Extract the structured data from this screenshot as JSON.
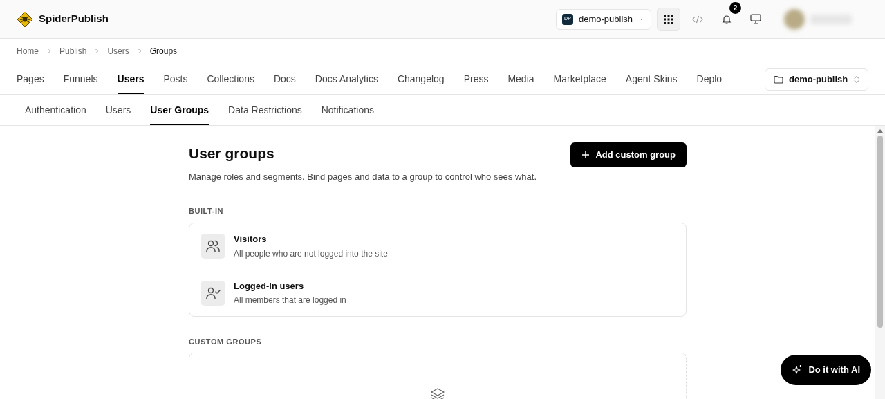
{
  "app": {
    "name": "SpiderPublish"
  },
  "header": {
    "workspace": {
      "badge": "DP",
      "name": "demo-publish"
    },
    "notifications": {
      "count": "2"
    }
  },
  "breadcrumb": [
    "Home",
    "Publish",
    "Users",
    "Groups"
  ],
  "tabs": [
    {
      "label": "Pages",
      "selected": false
    },
    {
      "label": "Funnels",
      "selected": false
    },
    {
      "label": "Users",
      "selected": true
    },
    {
      "label": "Posts",
      "selected": false
    },
    {
      "label": "Collections",
      "selected": false
    },
    {
      "label": "Docs",
      "selected": false
    },
    {
      "label": "Docs Analytics",
      "selected": false
    },
    {
      "label": "Changelog",
      "selected": false
    },
    {
      "label": "Press",
      "selected": false
    },
    {
      "label": "Media",
      "selected": false
    },
    {
      "label": "Marketplace",
      "selected": false
    },
    {
      "label": "Agent Skins",
      "selected": false
    },
    {
      "label": "Deplo",
      "selected": false
    }
  ],
  "project_select": {
    "value": "demo-publish"
  },
  "subtabs": [
    {
      "label": "Authentication",
      "selected": false
    },
    {
      "label": "Users",
      "selected": false
    },
    {
      "label": "User Groups",
      "selected": true
    },
    {
      "label": "Data Restrictions",
      "selected": false
    },
    {
      "label": "Notifications",
      "selected": false
    }
  ],
  "page": {
    "title": "User groups",
    "description": "Manage roles and segments. Bind pages and data to a group to control who sees what.",
    "add_button": "Add custom group"
  },
  "built_in": {
    "heading": "BUILT-IN",
    "groups": [
      {
        "kind": "visitors",
        "name": "Visitors",
        "description": "All people who are not logged into the site"
      },
      {
        "kind": "members",
        "name": "Logged-in users",
        "description": "All members that are logged in"
      }
    ]
  },
  "custom_groups": {
    "heading": "CUSTOM GROUPS"
  },
  "ai_button": {
    "label": "Do it with AI"
  }
}
